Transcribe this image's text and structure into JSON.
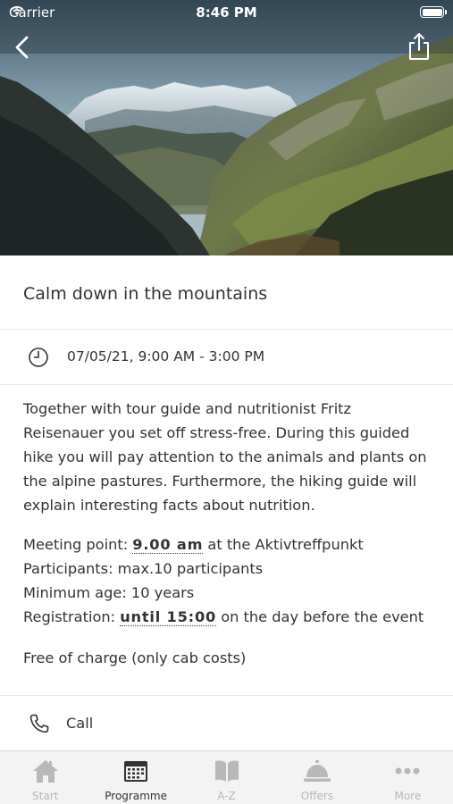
{
  "status_bar": {
    "carrier": "Carrier",
    "time": "8:46 PM"
  },
  "event": {
    "title": "Calm down in the mountains",
    "datetime": "07/05/21, 9:00 AM - 3:00 PM",
    "description": "Together with tour guide and nutritionist Fritz Reisenauer you set off stress-free. During this guided hike you will pay attention to the animals and plants on the alpine pastures. Furthermore, the hiking guide will explain interesting facts about nutrition.",
    "meeting_label": "Meeting point: ",
    "meeting_time": "9.00 am",
    "meeting_place": " at the Aktivtreffpunkt",
    "participants": "Participants: max.10 participants",
    "min_age": "Minimum age: 10 years",
    "registration_label": "Registration: ",
    "registration_time": "until 15:00",
    "registration_suffix": " on the day before the event",
    "cost": "Free of charge (only cab costs)"
  },
  "call_label": "Call",
  "tabs": [
    {
      "label": "Start",
      "icon": "home-icon",
      "active": false
    },
    {
      "label": "Programme",
      "icon": "calendar-icon",
      "active": true
    },
    {
      "label": "A-Z",
      "icon": "book-icon",
      "active": false
    },
    {
      "label": "Offers",
      "icon": "service-bell-icon",
      "active": false
    },
    {
      "label": "More",
      "icon": "more-dots-icon",
      "active": false
    }
  ],
  "colors": {
    "tab_active": "#333333",
    "tab_inactive": "#b8b8b8",
    "tab_bg": "#f3f3f3",
    "divider": "#e6e6e6"
  }
}
